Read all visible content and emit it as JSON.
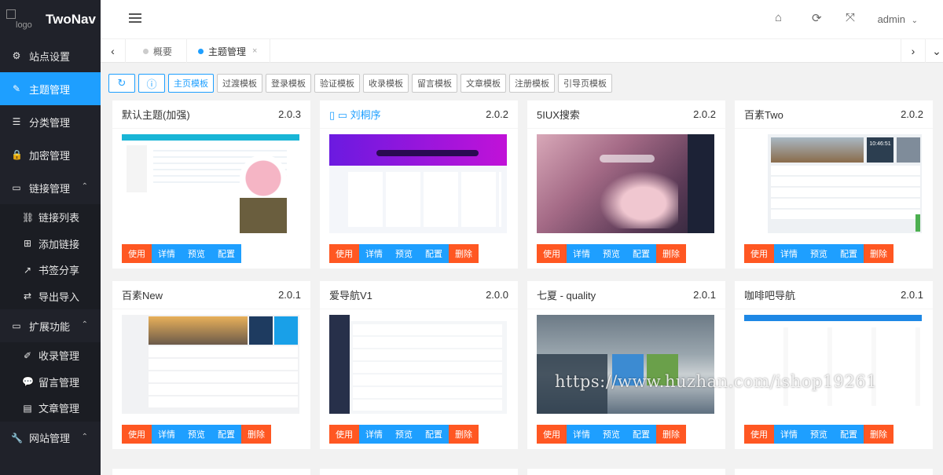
{
  "app": {
    "logo_alt": "logo",
    "name": "TwoNav"
  },
  "sidebar": {
    "items": [
      {
        "label": "站点设置",
        "icon": "gear-icon",
        "glyph": "⚙"
      },
      {
        "label": "主题管理",
        "icon": "brush-icon",
        "glyph": "✎",
        "active": true
      },
      {
        "label": "分类管理",
        "icon": "list-icon",
        "glyph": "☰"
      },
      {
        "label": "加密管理",
        "icon": "lock-icon",
        "glyph": "🔒"
      },
      {
        "label": "链接管理",
        "icon": "folder-icon",
        "glyph": "▭",
        "expanded": true,
        "children": [
          {
            "label": "链接列表",
            "icon": "link-icon",
            "glyph": "⛓"
          },
          {
            "label": "添加链接",
            "icon": "plus-square-icon",
            "glyph": "⊞"
          },
          {
            "label": "书签分享",
            "icon": "share-icon",
            "glyph": "↗"
          },
          {
            "label": "导出导入",
            "icon": "swap-icon",
            "glyph": "⇄"
          }
        ]
      },
      {
        "label": "扩展功能",
        "icon": "folder-icon",
        "glyph": "▭",
        "expanded": true,
        "children": [
          {
            "label": "收录管理",
            "icon": "pen-icon",
            "glyph": "✐"
          },
          {
            "label": "留言管理",
            "icon": "comment-icon",
            "glyph": "💬"
          },
          {
            "label": "文章管理",
            "icon": "document-icon",
            "glyph": "▤"
          }
        ]
      },
      {
        "label": "网站管理",
        "icon": "wrench-icon",
        "glyph": "🔧",
        "expanded": true
      }
    ]
  },
  "header": {
    "user": "admin",
    "icons": [
      "home-icon",
      "refresh-icon",
      "fullscreen-icon"
    ]
  },
  "tabs": [
    {
      "label": "概要",
      "active": false
    },
    {
      "label": "主题管理",
      "active": true,
      "close": "×"
    }
  ],
  "toolbar": {
    "refresh_glyph": "↻",
    "info_glyph": "ⓘ",
    "buttons": [
      "主页模板",
      "过渡模板",
      "登录模板",
      "验证模板",
      "收录模板",
      "留言模板",
      "文章模板",
      "注册模板",
      "引导页模板"
    ],
    "selected": "主页模板"
  },
  "themes": [
    {
      "title": "默认主题(加强)",
      "version": "2.0.3",
      "buttons": [
        "使用",
        "详情",
        "预览",
        "配置"
      ]
    },
    {
      "title": "刘桐序",
      "version": "2.0.2",
      "link": true,
      "buttons": [
        "使用",
        "详情",
        "预览",
        "配置",
        "删除"
      ]
    },
    {
      "title": "5IUX搜索",
      "version": "2.0.2",
      "buttons": [
        "使用",
        "详情",
        "预览",
        "配置",
        "删除"
      ]
    },
    {
      "title": "百素Two",
      "version": "2.0.2",
      "buttons": [
        "使用",
        "详情",
        "预览",
        "配置",
        "删除"
      ]
    },
    {
      "title": "百素New",
      "version": "2.0.1",
      "buttons": [
        "使用",
        "详情",
        "预览",
        "配置",
        "删除"
      ]
    },
    {
      "title": "爱导航V1",
      "version": "2.0.0",
      "buttons": [
        "使用",
        "详情",
        "预览",
        "配置",
        "删除"
      ]
    },
    {
      "title": "七夏 - quality",
      "version": "2.0.1",
      "buttons": [
        "使用",
        "详情",
        "预览",
        "配置",
        "删除"
      ]
    },
    {
      "title": "咖啡吧导航",
      "version": "2.0.1",
      "buttons": [
        "使用",
        "详情",
        "预览",
        "配置",
        "删除"
      ]
    }
  ],
  "watermark": "https://www.huzhan.com/ishop19261",
  "colors": {
    "accent": "#1e9fff",
    "danger": "#ff5722",
    "sidebar": "#20222a"
  }
}
